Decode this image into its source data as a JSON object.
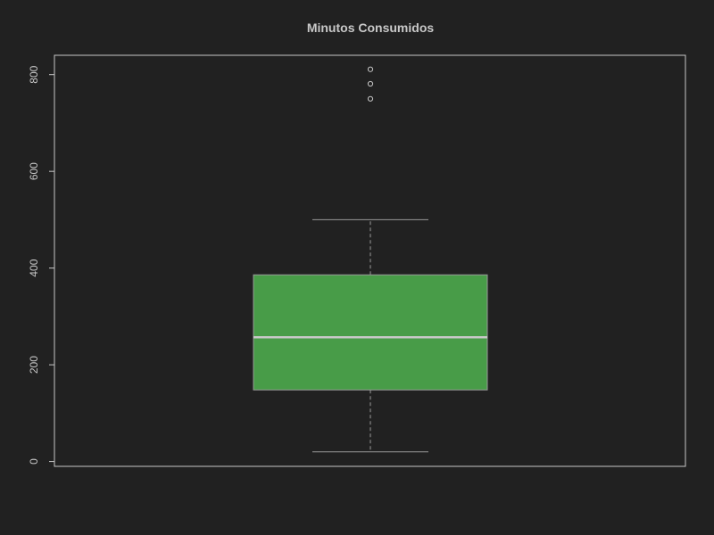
{
  "chart_data": {
    "type": "boxplot",
    "title": "Minutos Consumidos",
    "xlabel": "",
    "ylabel": "",
    "ylim": [
      -10,
      840
    ],
    "yticks": [
      0,
      200,
      400,
      600,
      800
    ],
    "box": {
      "min": 20,
      "q1": 148,
      "median": 257,
      "q3": 386,
      "max": 500
    },
    "outliers": [
      750,
      781,
      811
    ],
    "grid": false,
    "legend": "none"
  },
  "colors": {
    "background": "#212121",
    "foreground": "#c8c8c8",
    "box_fill": "#489c48",
    "median_line": "#c8c8c8",
    "whisker": "#9a9a9a"
  }
}
